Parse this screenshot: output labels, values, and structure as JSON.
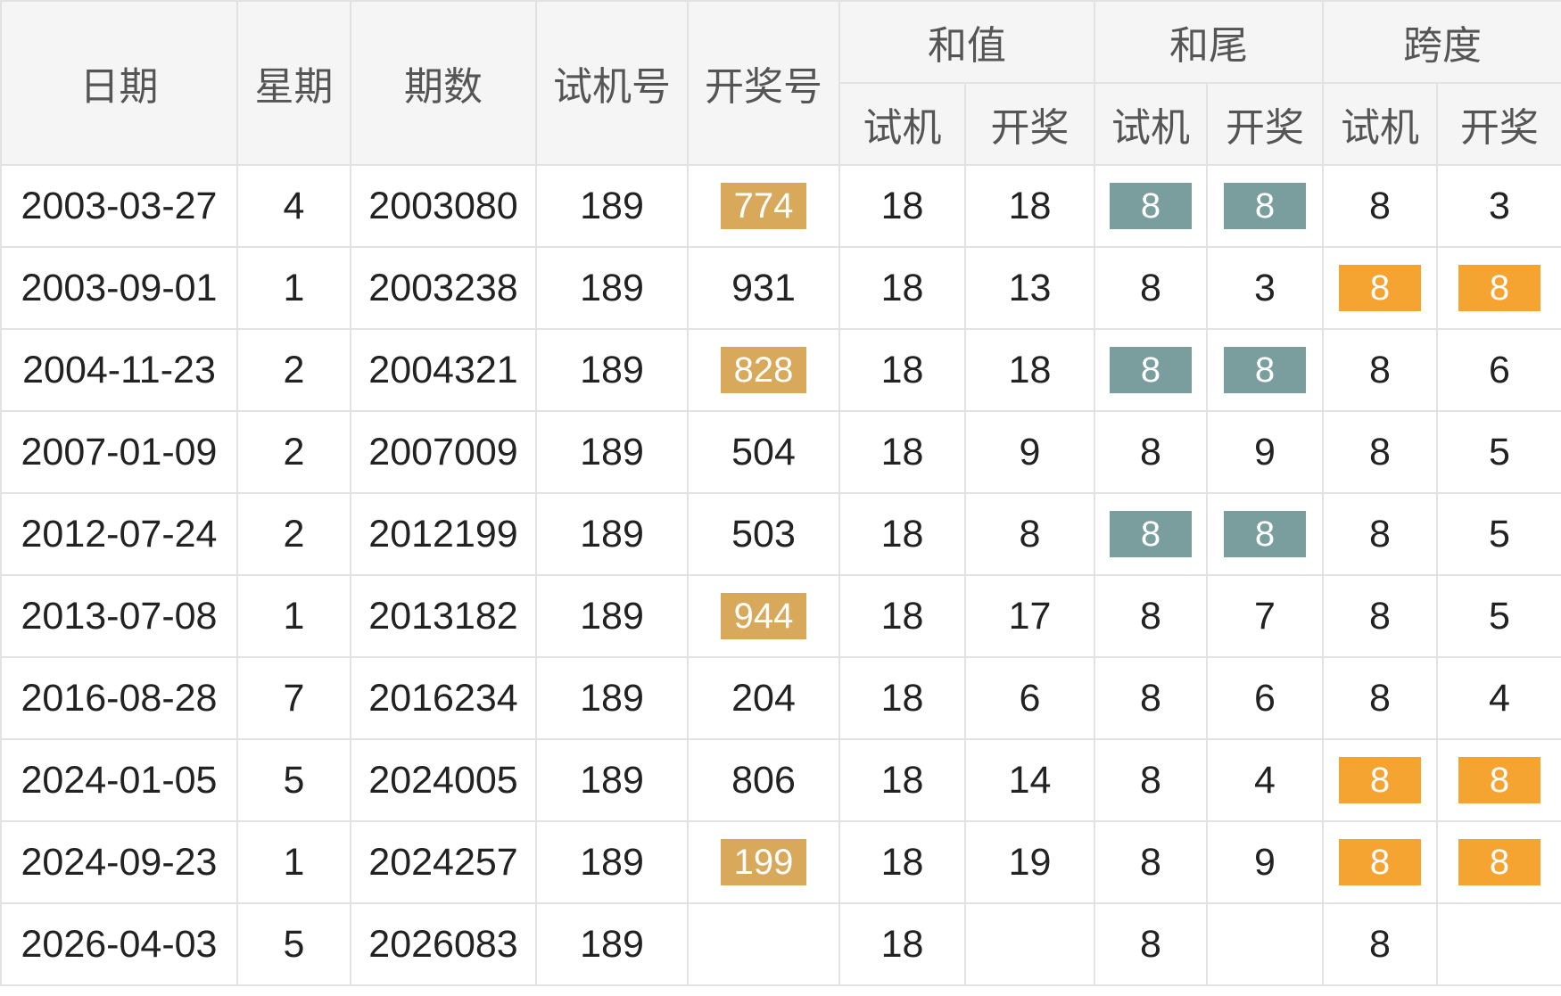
{
  "headers": {
    "date": "日期",
    "weekday": "星期",
    "issue": "期数",
    "trial": "试机号",
    "draw": "开奖号",
    "sum": "和值",
    "tail": "和尾",
    "span": "跨度",
    "sub_trial": "试机",
    "sub_draw": "开奖"
  },
  "colors": {
    "draw_highlight": "#d9a95b",
    "tail_highlight": "#7a9e9e",
    "span_highlight": "#f5a431",
    "red_text": "#c0392b"
  },
  "rows": [
    {
      "date": "2003-03-27",
      "weekday": "4",
      "issue": "2003080",
      "trial": "189",
      "draw": "774",
      "draw_hl": true,
      "sum_trial": "18",
      "sum_draw": "18",
      "tail_trial": "8",
      "tail_draw": "8",
      "tail_hl": true,
      "span_trial": "8",
      "span_draw": "3",
      "span_hl": false
    },
    {
      "date": "2003-09-01",
      "weekday": "1",
      "issue": "2003238",
      "trial": "189",
      "draw": "931",
      "draw_hl": false,
      "sum_trial": "18",
      "sum_draw": "13",
      "tail_trial": "8",
      "tail_draw": "3",
      "tail_hl": false,
      "span_trial": "8",
      "span_draw": "8",
      "span_hl": true
    },
    {
      "date": "2004-11-23",
      "weekday": "2",
      "issue": "2004321",
      "trial": "189",
      "draw": "828",
      "draw_hl": true,
      "sum_trial": "18",
      "sum_draw": "18",
      "tail_trial": "8",
      "tail_draw": "8",
      "tail_hl": true,
      "span_trial": "8",
      "span_draw": "6",
      "span_hl": false
    },
    {
      "date": "2007-01-09",
      "weekday": "2",
      "issue": "2007009",
      "trial": "189",
      "draw": "504",
      "draw_hl": false,
      "sum_trial": "18",
      "sum_draw": "9",
      "tail_trial": "8",
      "tail_draw": "9",
      "tail_hl": false,
      "span_trial": "8",
      "span_draw": "5",
      "span_hl": false
    },
    {
      "date": "2012-07-24",
      "weekday": "2",
      "issue": "2012199",
      "trial": "189",
      "draw": "503",
      "draw_hl": false,
      "sum_trial": "18",
      "sum_draw": "8",
      "tail_trial": "8",
      "tail_draw": "8",
      "tail_hl": true,
      "span_trial": "8",
      "span_draw": "5",
      "span_hl": false
    },
    {
      "date": "2013-07-08",
      "weekday": "1",
      "issue": "2013182",
      "trial": "189",
      "draw": "944",
      "draw_hl": true,
      "sum_trial": "18",
      "sum_draw": "17",
      "tail_trial": "8",
      "tail_draw": "7",
      "tail_hl": false,
      "span_trial": "8",
      "span_draw": "5",
      "span_hl": false
    },
    {
      "date": "2016-08-28",
      "weekday": "7",
      "issue": "2016234",
      "trial": "189",
      "draw": "204",
      "draw_hl": false,
      "sum_trial": "18",
      "sum_draw": "6",
      "tail_trial": "8",
      "tail_draw": "6",
      "tail_hl": false,
      "span_trial": "8",
      "span_draw": "4",
      "span_hl": false
    },
    {
      "date": "2024-01-05",
      "weekday": "5",
      "issue": "2024005",
      "trial": "189",
      "draw": "806",
      "draw_hl": false,
      "sum_trial": "18",
      "sum_draw": "14",
      "tail_trial": "8",
      "tail_draw": "4",
      "tail_hl": false,
      "span_trial": "8",
      "span_draw": "8",
      "span_hl": true
    },
    {
      "date": "2024-09-23",
      "weekday": "1",
      "issue": "2024257",
      "trial": "189",
      "draw": "199",
      "draw_hl": true,
      "sum_trial": "18",
      "sum_draw": "19",
      "tail_trial": "8",
      "tail_draw": "9",
      "tail_hl": false,
      "span_trial": "8",
      "span_draw": "8",
      "span_hl": true
    },
    {
      "date": "2026-04-03",
      "weekday": "5",
      "issue": "2026083",
      "trial": "189",
      "draw": "",
      "draw_hl": false,
      "sum_trial": "18",
      "sum_draw": "",
      "tail_trial": "8",
      "tail_draw": "",
      "tail_hl": false,
      "span_trial": "8",
      "span_draw": "",
      "span_hl": false
    }
  ]
}
